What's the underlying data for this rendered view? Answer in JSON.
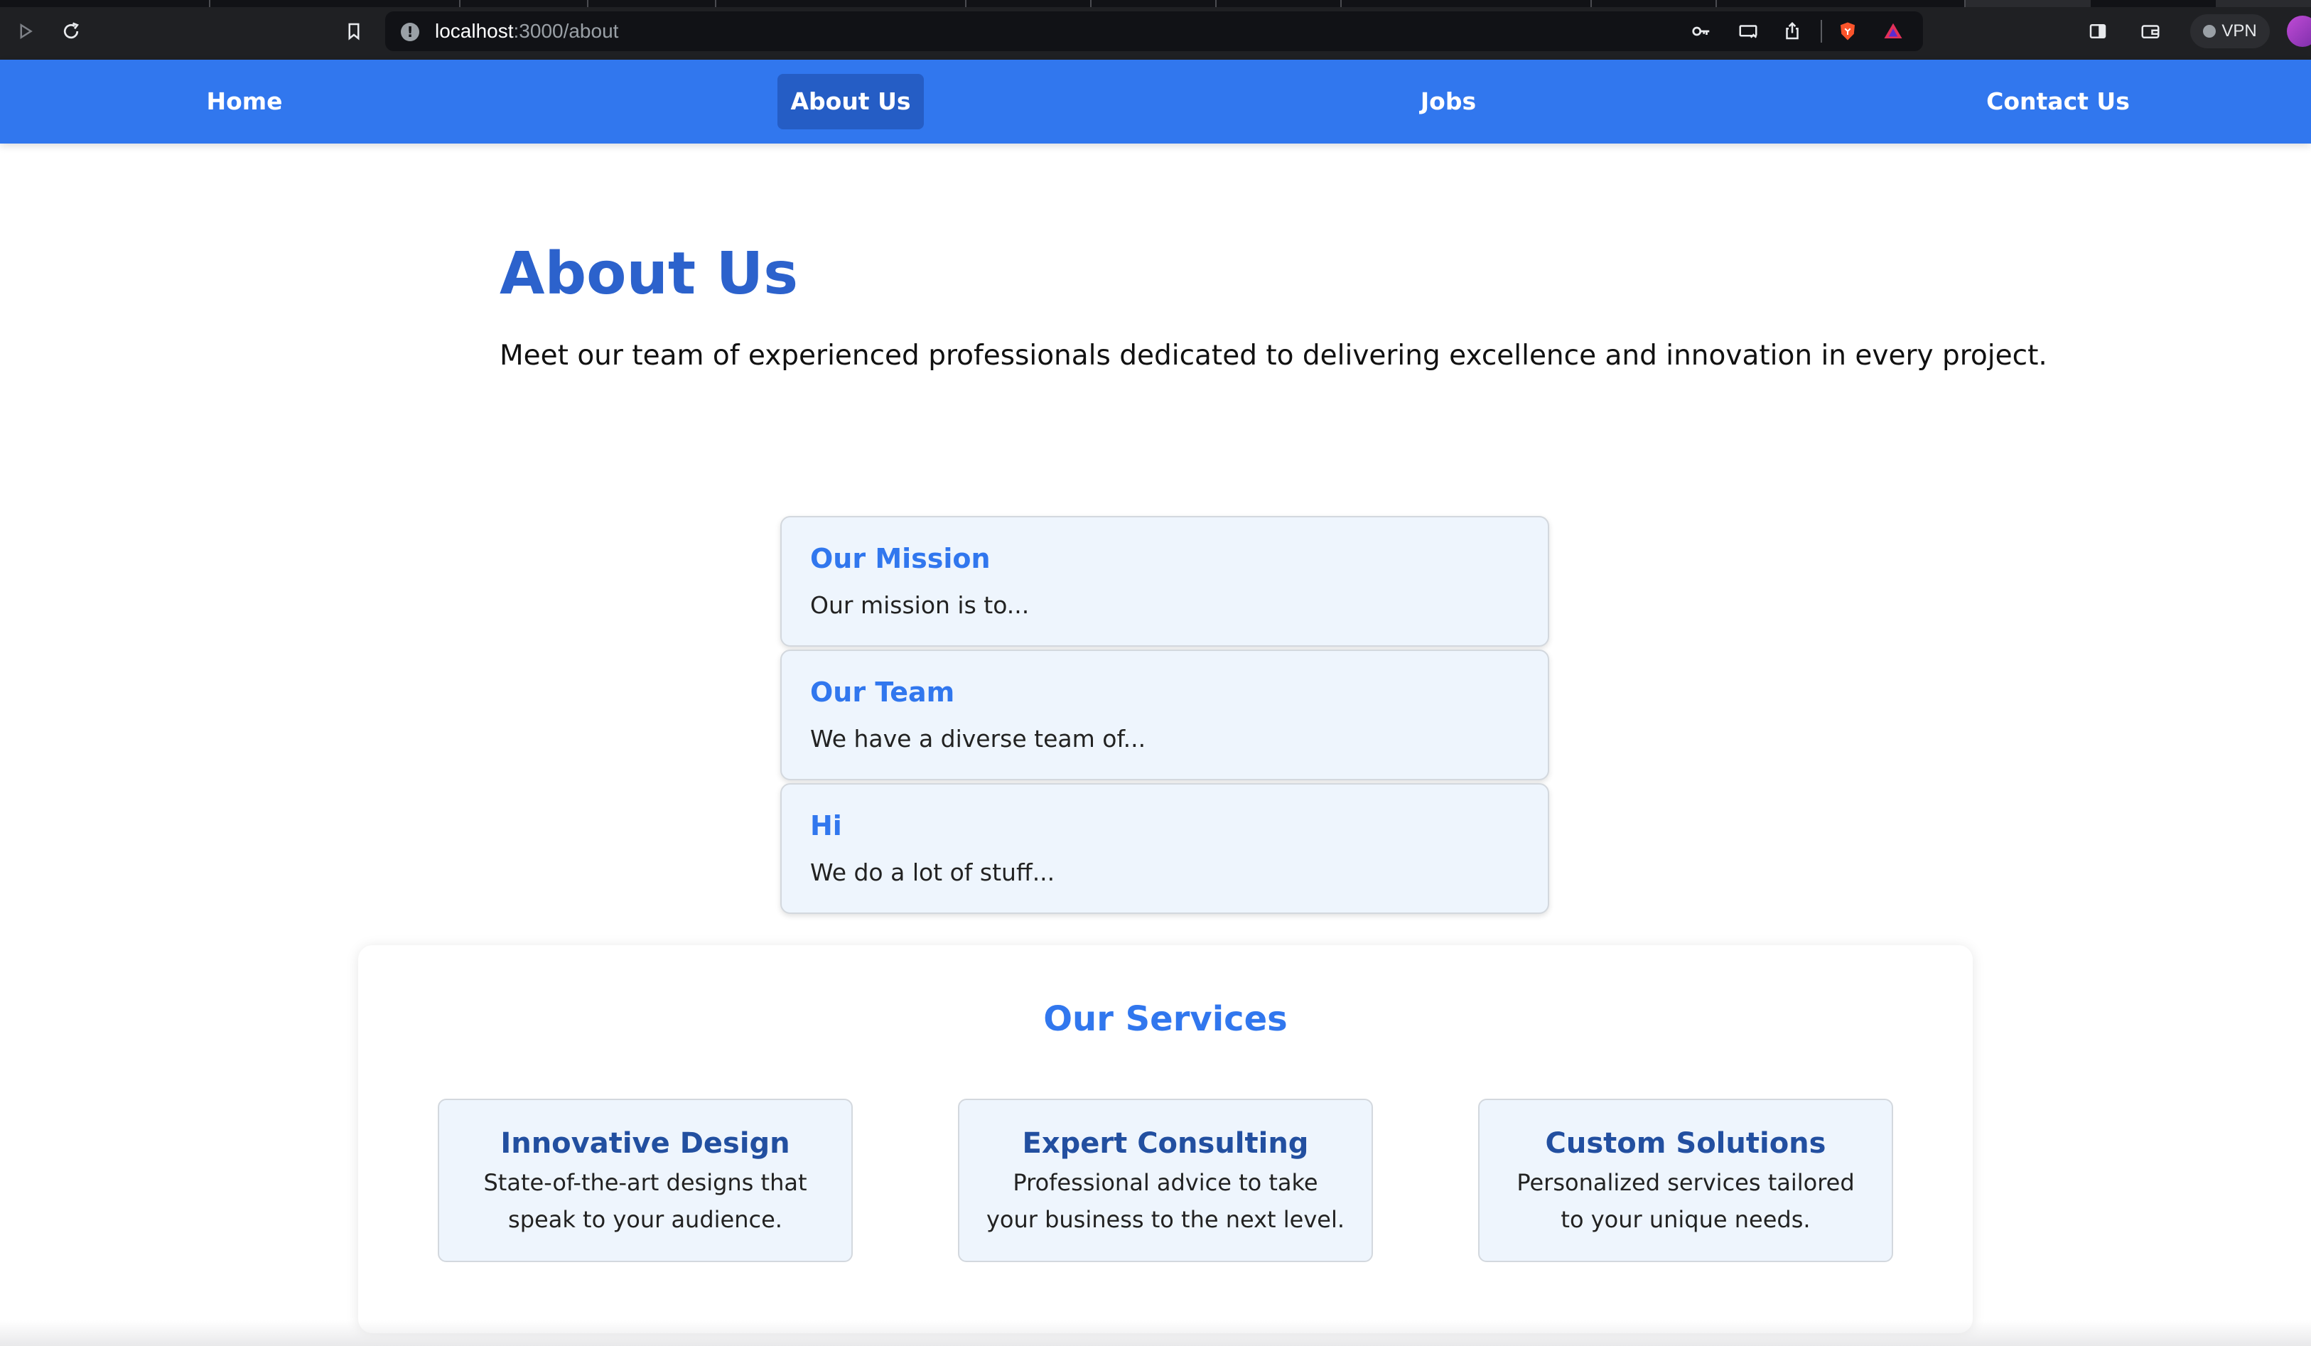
{
  "browser": {
    "url_host": "localhost",
    "url_path": ":3000/about",
    "vpn_label": "VPN"
  },
  "nav": {
    "items": [
      {
        "label": "Home",
        "active": false
      },
      {
        "label": "About Us",
        "active": true
      },
      {
        "label": "Jobs",
        "active": false
      },
      {
        "label": "Contact Us",
        "active": false
      }
    ]
  },
  "about": {
    "title": "About Us",
    "intro": "Meet our team of experienced professionals dedicated to delivering excellence and innovation in every project."
  },
  "cards": [
    {
      "title": "Our Mission",
      "text": "Our mission is to..."
    },
    {
      "title": "Our Team",
      "text": "We have a diverse team of..."
    },
    {
      "title": "Hi",
      "text": "We do a lot of stuff..."
    }
  ],
  "services": {
    "heading": "Our Services",
    "items": [
      {
        "title": "Innovative Design",
        "text": "State-of-the-art designs that speak to your audience."
      },
      {
        "title": "Expert Consulting",
        "text": "Professional advice to take your business to the next level."
      },
      {
        "title": "Custom Solutions",
        "text": "Personalized services tailored to your unique needs."
      }
    ]
  },
  "colors": {
    "nav_bg": "#3177ee",
    "nav_active": "#255dc5",
    "heading_blue": "#2c62cc",
    "card_bg": "#eef5fd"
  }
}
